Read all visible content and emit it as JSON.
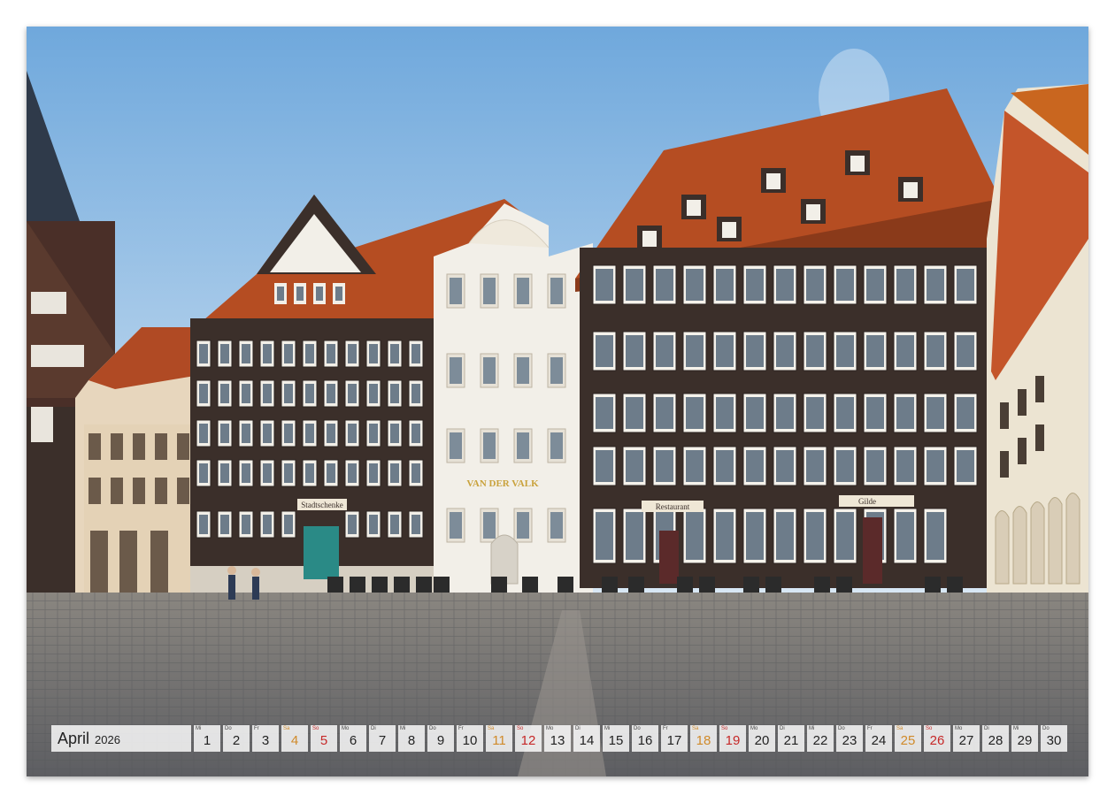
{
  "calendar": {
    "month": "April",
    "year": "2026",
    "days": [
      {
        "dow": "Mi",
        "num": "1",
        "kind": "weekday"
      },
      {
        "dow": "Do",
        "num": "2",
        "kind": "weekday"
      },
      {
        "dow": "Fr",
        "num": "3",
        "kind": "holiday"
      },
      {
        "dow": "Sa",
        "num": "4",
        "kind": "sat"
      },
      {
        "dow": "So",
        "num": "5",
        "kind": "sun"
      },
      {
        "dow": "Mo",
        "num": "6",
        "kind": "holiday"
      },
      {
        "dow": "Di",
        "num": "7",
        "kind": "weekday"
      },
      {
        "dow": "Mi",
        "num": "8",
        "kind": "weekday"
      },
      {
        "dow": "Do",
        "num": "9",
        "kind": "weekday"
      },
      {
        "dow": "Fr",
        "num": "10",
        "kind": "weekday"
      },
      {
        "dow": "Sa",
        "num": "11",
        "kind": "sat"
      },
      {
        "dow": "So",
        "num": "12",
        "kind": "sun"
      },
      {
        "dow": "Mo",
        "num": "13",
        "kind": "weekday"
      },
      {
        "dow": "Di",
        "num": "14",
        "kind": "weekday"
      },
      {
        "dow": "Mi",
        "num": "15",
        "kind": "weekday"
      },
      {
        "dow": "Do",
        "num": "16",
        "kind": "weekday"
      },
      {
        "dow": "Fr",
        "num": "17",
        "kind": "weekday"
      },
      {
        "dow": "Sa",
        "num": "18",
        "kind": "sat"
      },
      {
        "dow": "So",
        "num": "19",
        "kind": "sun"
      },
      {
        "dow": "Mo",
        "num": "20",
        "kind": "weekday"
      },
      {
        "dow": "Di",
        "num": "21",
        "kind": "weekday"
      },
      {
        "dow": "Mi",
        "num": "22",
        "kind": "weekday"
      },
      {
        "dow": "Do",
        "num": "23",
        "kind": "weekday"
      },
      {
        "dow": "Fr",
        "num": "24",
        "kind": "weekday"
      },
      {
        "dow": "Sa",
        "num": "25",
        "kind": "sat"
      },
      {
        "dow": "So",
        "num": "26",
        "kind": "sun"
      },
      {
        "dow": "Mo",
        "num": "27",
        "kind": "weekday"
      },
      {
        "dow": "Di",
        "num": "28",
        "kind": "weekday"
      },
      {
        "dow": "Mi",
        "num": "29",
        "kind": "weekday"
      },
      {
        "dow": "Do",
        "num": "30",
        "kind": "weekday"
      }
    ]
  },
  "signs": {
    "van_der_valk": "VAN DER VALK",
    "stadtschenke": "Stadtschenke",
    "restaurant": "Restaurant",
    "gilde": "Gilde"
  },
  "colors": {
    "sky_top": "#6fa8dc",
    "sky_bottom": "#dbe9f5",
    "roof": "#b54d22",
    "timber": "#3b2f2a",
    "render": "#f2efe8",
    "cobble": "#6e6f72",
    "door_teal": "#2a8a86"
  }
}
